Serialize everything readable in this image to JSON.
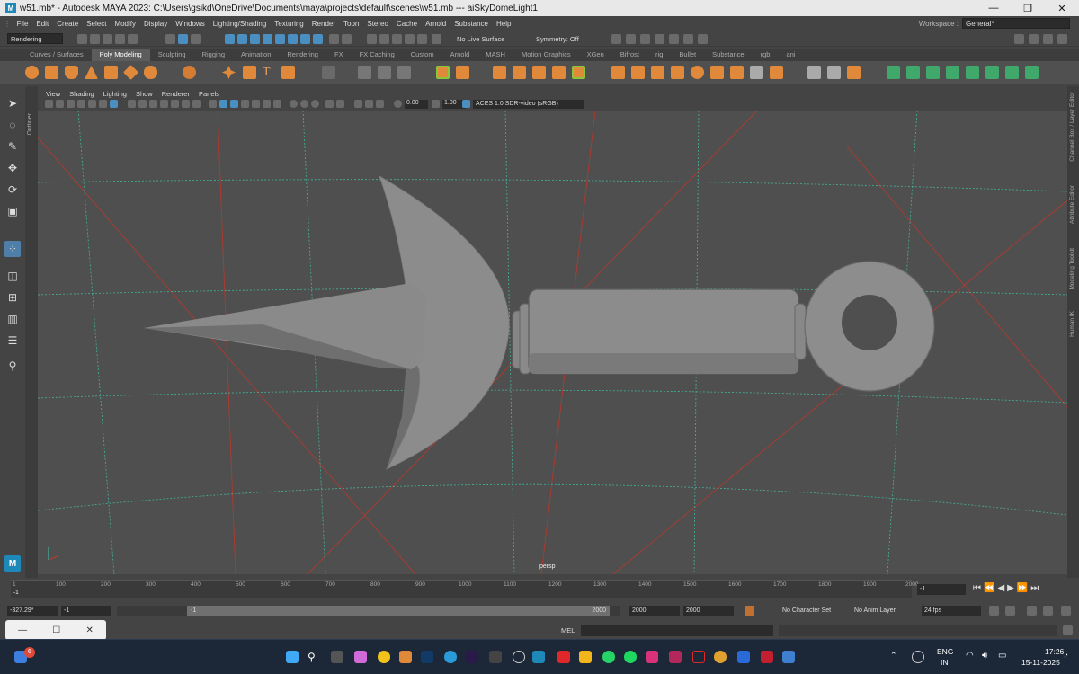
{
  "window": {
    "title": "w51.mb* - Autodesk MAYA 2023: C:\\Users\\gsikd\\OneDrive\\Documents\\maya\\projects\\default\\scenes\\w51.mb   ---   aiSkyDomeLight1",
    "app_icon": "M",
    "minimize": "—",
    "maximize": "❐",
    "close": "✕"
  },
  "menu": [
    "File",
    "Edit",
    "Create",
    "Select",
    "Modify",
    "Display",
    "Windows",
    "Lighting/Shading",
    "Texturing",
    "Render",
    "Toon",
    "Stereo",
    "Cache",
    "Arnold",
    "Substance",
    "Help"
  ],
  "workspace": {
    "label": "Workspace :",
    "value": "General*"
  },
  "status_line": {
    "menuset": "Rendering",
    "live_surface": "No Live Surface",
    "symmetry": "Symmetry: Off"
  },
  "shelf_tabs": [
    "Curves / Surfaces",
    "Poly Modeling",
    "Sculpting",
    "Rigging",
    "Animation",
    "Rendering",
    "FX",
    "FX Caching",
    "Custom",
    "Arnold",
    "MASH",
    "Motion Graphics",
    "XGen",
    "Bifrost",
    "rig",
    "Bullet",
    "Substance",
    "rgb",
    "ani"
  ],
  "active_shelf": "Poly Modeling",
  "panel_menu": [
    "View",
    "Shading",
    "Lighting",
    "Show",
    "Renderer",
    "Panels"
  ],
  "view_toolbar": {
    "exposure": "0.00",
    "gamma": "1.00",
    "color_space": "ACES 1.0 SDR-video (sRGB)"
  },
  "camera_label": "persp",
  "side_tabs": [
    "Channel Box / Layer Editor",
    "Attribute Editor",
    "Modeling Toolkit",
    "Human IK"
  ],
  "outliner_tab": "Outliner",
  "timeline": {
    "ticks": [
      "1",
      "100",
      "200",
      "300",
      "400",
      "500",
      "600",
      "700",
      "800",
      "900",
      "1000",
      "1100",
      "1200",
      "1300",
      "1400",
      "1500",
      "1600",
      "1700",
      "1800",
      "1900",
      "2000"
    ],
    "current_frame": "-1"
  },
  "range": {
    "start_field": "-327.29*",
    "start2": "-1",
    "slider_start": "-1",
    "slider_end": "2000",
    "end1": "2000",
    "end2": "2000",
    "character_set": "No Character Set",
    "anim_layer": "No Anim Layer",
    "fps": "24 fps"
  },
  "command": {
    "mode": "MEL"
  },
  "taskbar": {
    "badge": "6",
    "lang": "ENG",
    "region": "IN",
    "time": "17:26",
    "date": "15-11-2025"
  },
  "colors": {
    "viewport_bg": "#4f4f4f",
    "grid": "#4ec9b0",
    "axis": "#c0392b",
    "mesh": "#8c8c8c",
    "accent": "#4a8fc2"
  }
}
